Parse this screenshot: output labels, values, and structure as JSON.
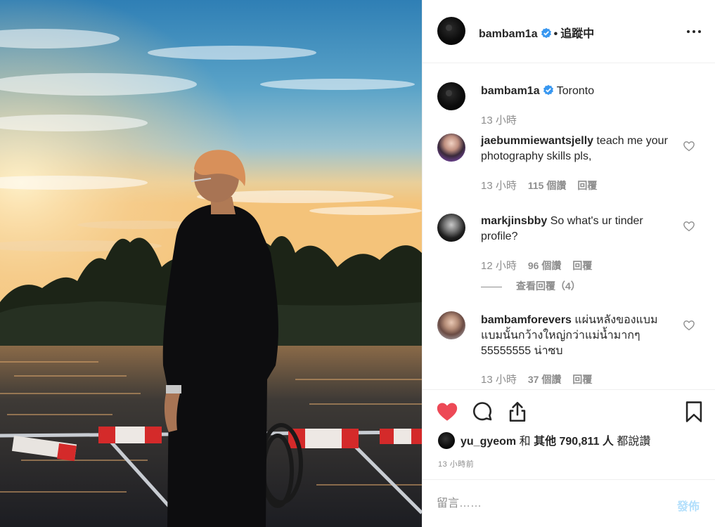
{
  "post": {
    "author": "bambam1a",
    "follow_separator": "•",
    "follow_status": "追蹤中",
    "caption_text": "Toronto",
    "caption_time": "13 小時"
  },
  "comments": [
    {
      "user": "jaebummiewantsjelly",
      "text": "teach me your photography skills pls,",
      "time": "13 小時",
      "likes": "115 個讚",
      "reply": "回覆"
    },
    {
      "user": "markjinsbby",
      "text": "So what's ur tinder profile?",
      "time": "12 小時",
      "likes": "96 個讚",
      "reply": "回覆",
      "view_replies": "查看回覆（4）"
    },
    {
      "user": "bambamforevers",
      "text": "แผ่นหลังของแบมแบมนั้นกว้างใหญ่กว่าแม่น้ำมากๆ 55555555 น่าซบ",
      "time": "13 小時",
      "likes": "37 個讚",
      "reply": "回覆"
    }
  ],
  "likes_summary": {
    "user": "yu_gyeom",
    "connector": "和",
    "others": "其他 790,811 人",
    "suffix": "都說讚"
  },
  "posted_time": "13 小時前",
  "compose": {
    "placeholder": "留言……",
    "post_label": "發佈"
  },
  "colors": {
    "heart_liked": "#ed4956",
    "verified": "#3897f0",
    "muted": "#8e8e8e",
    "post_disabled": "#b2dffc"
  },
  "icons": {
    "more": "more-horizontal-icon",
    "like": "heart-filled-icon",
    "comment": "comment-bubble-icon",
    "share": "share-icon",
    "save": "bookmark-icon",
    "comment_like": "heart-outline-icon",
    "verified": "verified-badge-icon"
  }
}
